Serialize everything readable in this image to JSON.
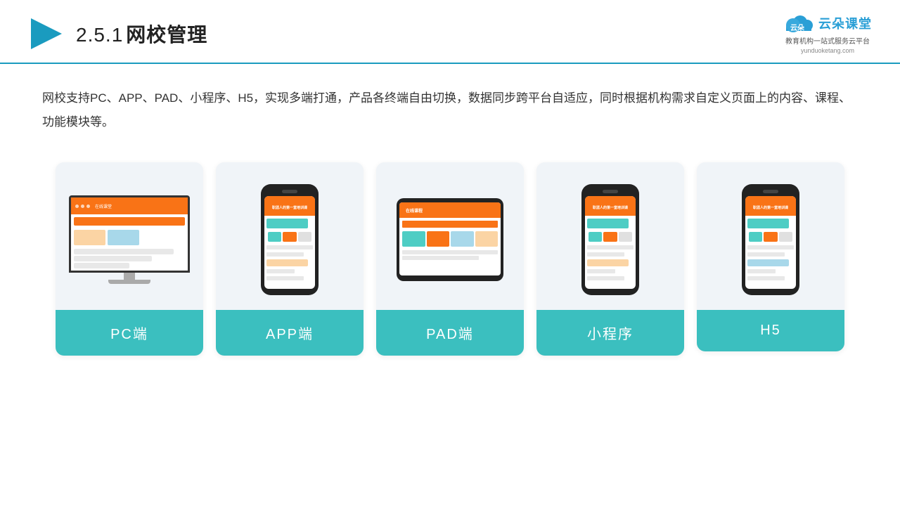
{
  "header": {
    "section_number": "2.5.1",
    "title": "网校管理",
    "logo_brand": "云朵课堂",
    "logo_url": "yunduoketang.com",
    "logo_tagline": "教育机构一站\n式服务云平台"
  },
  "description": {
    "text": "网校支持PC、APP、PAD、小程序、H5，实现多端打通，产品各终端自由切换，数据同步跨平台自适应，同时根据机构需求自定义页面上的内容、课程、功能模块等。"
  },
  "cards": [
    {
      "id": "pc",
      "label": "PC端"
    },
    {
      "id": "app",
      "label": "APP端"
    },
    {
      "id": "pad",
      "label": "PAD端"
    },
    {
      "id": "miniprogram",
      "label": "小程序"
    },
    {
      "id": "h5",
      "label": "H5"
    }
  ],
  "accent_color": "#3bbfbf",
  "border_color": "#1a9bbf"
}
